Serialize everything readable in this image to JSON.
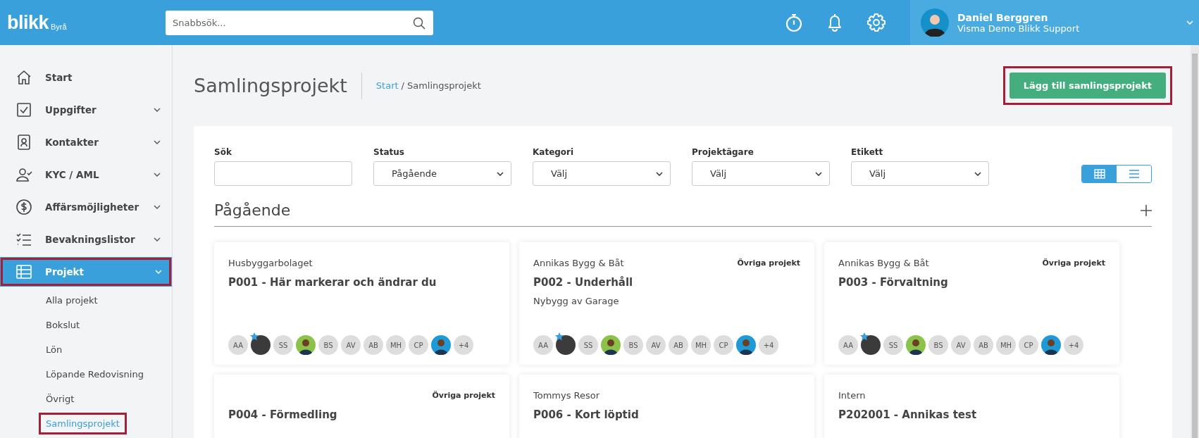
{
  "header": {
    "logo": "blikk",
    "logo_sub": "Byrå",
    "search": {
      "placeholder": "Snabbsök..."
    },
    "user": {
      "name": "Daniel Berggren",
      "org": "Visma Demo Blikk Support"
    }
  },
  "sidebar": {
    "items": [
      {
        "label": "Start",
        "expandable": false,
        "selected": false,
        "highlighted": false
      },
      {
        "label": "Uppgifter",
        "expandable": true,
        "selected": false,
        "highlighted": false
      },
      {
        "label": "Kontakter",
        "expandable": true,
        "selected": false,
        "highlighted": false
      },
      {
        "label": "KYC / AML",
        "expandable": true,
        "selected": false,
        "highlighted": false
      },
      {
        "label": "Affärsmöjligheter",
        "expandable": true,
        "selected": false,
        "highlighted": false
      },
      {
        "label": "Bevakningslistor",
        "expandable": true,
        "selected": false,
        "highlighted": false
      },
      {
        "label": "Projekt",
        "expandable": true,
        "selected": true,
        "highlighted": true,
        "children": [
          {
            "label": "Alla projekt",
            "selected": false,
            "highlighted": false
          },
          {
            "label": "Bokslut",
            "selected": false,
            "highlighted": false
          },
          {
            "label": "Lön",
            "selected": false,
            "highlighted": false
          },
          {
            "label": "Löpande Redovisning",
            "selected": false,
            "highlighted": false
          },
          {
            "label": "Övrigt",
            "selected": false,
            "highlighted": false
          },
          {
            "label": "Samlingsprojekt",
            "selected": true,
            "highlighted": true
          }
        ]
      }
    ]
  },
  "page": {
    "title": "Samlingsprojekt",
    "breadcrumb": [
      {
        "label": "Start",
        "link": true
      },
      {
        "label": "/",
        "link": false
      },
      {
        "label": "Samlingsprojekt",
        "link": false
      }
    ],
    "add_button": {
      "label": "Lägg till samlingsprojekt",
      "highlighted": true
    }
  },
  "filters": [
    {
      "label": "Sök",
      "kind": "text"
    },
    {
      "label": "Status",
      "kind": "select",
      "value": "Pågående"
    },
    {
      "label": "Kategori",
      "kind": "select",
      "value": "Välj"
    },
    {
      "label": "Projektägare",
      "kind": "select",
      "value": "Välj"
    },
    {
      "label": "Etikett",
      "kind": "select",
      "value": "Välj"
    }
  ],
  "view_toggle": [
    {
      "kind": "grid",
      "selected": true
    },
    {
      "kind": "list",
      "selected": false
    }
  ],
  "section": {
    "title": "Pågående"
  },
  "cards": [
    {
      "company": "Husbyggarbolaget",
      "title": "P001 - Här markerar och ändrar du",
      "members": [
        {
          "kind": "initials",
          "text": "AA"
        },
        {
          "kind": "photo",
          "starred": true
        },
        {
          "kind": "initials",
          "text": "SS"
        },
        {
          "kind": "illustration",
          "color": "#8bc34a"
        },
        {
          "kind": "initials",
          "text": "BS"
        },
        {
          "kind": "initials",
          "text": "AV"
        },
        {
          "kind": "initials",
          "text": "AB"
        },
        {
          "kind": "initials",
          "text": "MH"
        },
        {
          "kind": "initials",
          "text": "CP"
        },
        {
          "kind": "illustration",
          "color": "#1e9ad6"
        },
        {
          "kind": "initials",
          "text": "+4"
        }
      ]
    },
    {
      "company": "Annikas Bygg & Båt",
      "category": "Övriga projekt",
      "title": "P002 - Underhåll",
      "subtitle": "Nybygg av Garage",
      "members": [
        {
          "kind": "initials",
          "text": "AA"
        },
        {
          "kind": "photo",
          "starred": true
        },
        {
          "kind": "initials",
          "text": "SS"
        },
        {
          "kind": "illustration",
          "color": "#8bc34a"
        },
        {
          "kind": "initials",
          "text": "BS"
        },
        {
          "kind": "initials",
          "text": "AV"
        },
        {
          "kind": "initials",
          "text": "AB"
        },
        {
          "kind": "initials",
          "text": "MH"
        },
        {
          "kind": "initials",
          "text": "CP"
        },
        {
          "kind": "illustration",
          "color": "#1e9ad6"
        },
        {
          "kind": "initials",
          "text": "+4"
        }
      ]
    },
    {
      "company": "Annikas Bygg & Båt",
      "category": "Övriga projekt",
      "title": "P003 - Förvaltning",
      "members": [
        {
          "kind": "initials",
          "text": "AA"
        },
        {
          "kind": "photo",
          "starred": true
        },
        {
          "kind": "initials",
          "text": "SS"
        },
        {
          "kind": "illustration",
          "color": "#8bc34a"
        },
        {
          "kind": "initials",
          "text": "BS"
        },
        {
          "kind": "initials",
          "text": "AV"
        },
        {
          "kind": "initials",
          "text": "AB"
        },
        {
          "kind": "initials",
          "text": "MH"
        },
        {
          "kind": "initials",
          "text": "CP"
        },
        {
          "kind": "illustration",
          "color": "#1e9ad6"
        },
        {
          "kind": "initials",
          "text": "+4"
        }
      ]
    },
    {
      "category": "Övriga projekt",
      "title": "P004 - Förmedling"
    },
    {
      "company": "Tommys Resor",
      "title": "P006 - Kort löptid"
    },
    {
      "company": "Intern",
      "title": "P202001 - Annikas test"
    }
  ]
}
